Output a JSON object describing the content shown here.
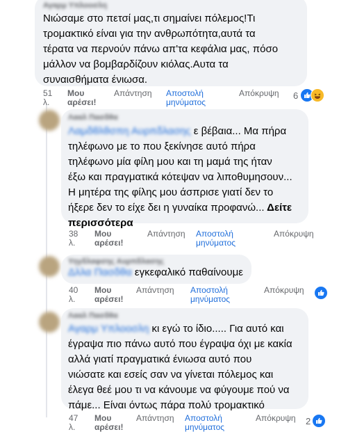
{
  "comments": [
    {
      "author": "Αγαρμ Υπλοοσλη",
      "text": "Νιώσαμε στο πετσί μας,τι σημαίνει πόλεμος!Τι\nτρομακτικό είναι για την ανθρωπότητα,αυτά τα\nτέρατα να περνούν πάνω απ'τα κεφάλια μας, πόσο\nμάλλον να βομβαρδίζουν κιόλας.Αυτα τα\nσυναισθήματα ένιωσα.",
      "time": "51\nλ.",
      "like": "Μου\nαρέσει!",
      "reply": "Απάντηση",
      "send": "Αποστολή\nμηνύματος",
      "hide": "Απόκρυψη",
      "reaction_count": "6"
    },
    {
      "author": "Λααλ Πασδθα",
      "mention": "Λαμδθλθσπη Αυρπδλασης",
      "text_after_mention": " ε βέβαια... Μα πήρα",
      "text": "τηλέφωνο με το που ξεκίνησε αυτό πήρα\nτηλέφωνο μία φίλη μου και τη μαμά της ήταν\nέξω και πραγματικά κότεψαν να λιποθυμησουν...\nΗ μητέρα της φίλης μου άσπρισε γιατί δεν το\nήξερε δεν το είχε δει η γυναίκα προφανώ...",
      "see_more": "Δείτε\nπερισσότερα",
      "time": "38\nλ.",
      "like": "Μου\nαρέσει!",
      "reply": "Απάντηση",
      "send": "Αποστολή\nμηνύματος",
      "hide": "Απόκρυψη"
    },
    {
      "author": "Υηγδλαφσης Αυρπδλασης",
      "mention": "Δλλα Πασδθα",
      "text_after_mention": " εγκεφαλικό παθαίνουμε",
      "time": "40\nλ.",
      "like": "Μου\nαρέσει!",
      "reply": "Απάντηση",
      "send": "Αποστολή\nμηνύματος",
      "hide": "Απόκρυψη",
      "reaction_count": ""
    },
    {
      "author": "Λααλ Πασδθα",
      "mention": "Αγαρμ Υπλοοσλη",
      "text_after_mention": " κι εγώ το ίδιο..... Για αυτό και",
      "text": "έγραψα πιο πάνω αυτό που έγραψα όχι με κακία\nαλλά γιατί πραγματικά ένιωσα αυτό που\nνιώσατε και εσείς σαν να γίνεται πόλεμος και\nέλεγα θεέ μου τι να κάνουμε να φύγουμε πού να\nπάμε... Είναι όντως πάρα πολύ τρομακτικό",
      "time": "47\nλ.",
      "like": "Μου\nαρέσει!",
      "reply": "Απάντηση",
      "send": "Αποστολή\nμηνύματος",
      "hide": "Απόκρυψη",
      "reaction_count": "2"
    }
  ],
  "colors": {
    "bubble": "#f0f2f5",
    "link": "#216fdb",
    "like": "#1877f2",
    "haha": "#f7b928",
    "muted": "#65676b"
  },
  "icons": {
    "like": "like-reaction-icon",
    "haha": "haha-reaction-icon"
  }
}
